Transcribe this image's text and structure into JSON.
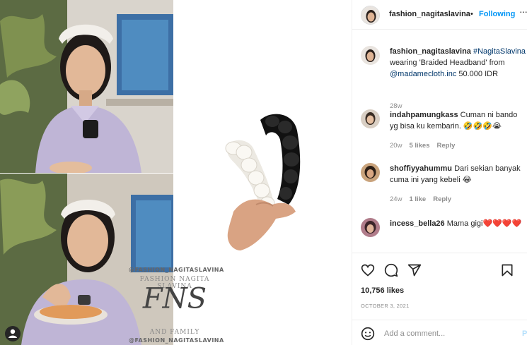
{
  "post": {
    "username": "fashion_nagitaslavina",
    "separator": "•",
    "follow_label": "Following",
    "more_label": "···"
  },
  "caption": {
    "username": "fashion_nagitaslavina",
    "hashtag": "#NagitaSlavina",
    "text_before": " wearing 'Braided Headband' from",
    "mention": "@madamecloth.inc",
    "text_after": " 50.000 IDR",
    "age": "28w"
  },
  "comments": [
    {
      "username": "indahpamungkass",
      "text": " Cuman ni bando yg bisa ku kembarin. 🤣🤣🤣😭",
      "age": "20w",
      "likes": "5 likes",
      "reply": "Reply"
    },
    {
      "username": "shoffiyyahummu",
      "text": " Dari sekian banyak cuma ini yang kebeli 😂",
      "age": "24w",
      "likes": "1 like",
      "reply": "Reply"
    },
    {
      "username": "incess_bella26",
      "text": " Mama gigi❤️❤️❤️❤️",
      "age": "",
      "likes": "",
      "reply": ""
    }
  ],
  "likes_count": "10,756 likes",
  "date": "OCTOBER 3, 2021",
  "add_comment_placeholder": "Add a comment...",
  "post_label": "P",
  "watermark": {
    "line1": "@FASHION_NAGITASLAVINA",
    "line2": "FASHION NAGITA SLAVINA",
    "logo": "FNS",
    "line3": "AND FAMILY",
    "line4": "@FASHION_NAGITASLAVINA"
  },
  "icons": [
    "heart-icon",
    "comment-icon",
    "share-icon",
    "bookmark-icon",
    "emoji-icon",
    "more-icon",
    "user-tag-icon"
  ],
  "colors": {
    "accent": "#0095f6",
    "link": "#00376b",
    "muted": "#8e8e8e",
    "like_red": "#ed4956"
  }
}
